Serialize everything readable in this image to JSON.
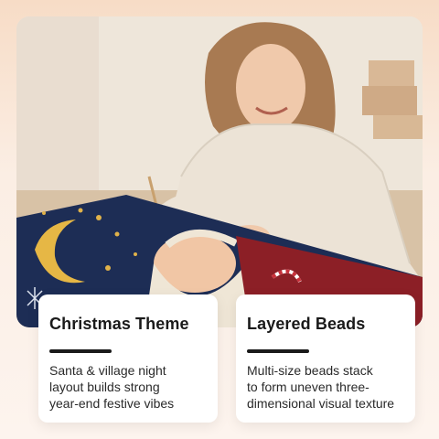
{
  "photo": {
    "description_icon": "woman-painting-diamond-art-image"
  },
  "features": [
    {
      "title": "Christmas Theme",
      "lines": [
        "Santa & village night",
        "layout builds strong",
        "year-end festive vibes"
      ]
    },
    {
      "title": "Layered Beads",
      "lines": [
        "Multi-size beads stack",
        "to form uneven three-",
        "dimensional visual texture"
      ]
    }
  ],
  "colors": {
    "accent": "#1a1a1a",
    "card_bg": "#ffffff",
    "page_bg": "#fbeee4"
  }
}
